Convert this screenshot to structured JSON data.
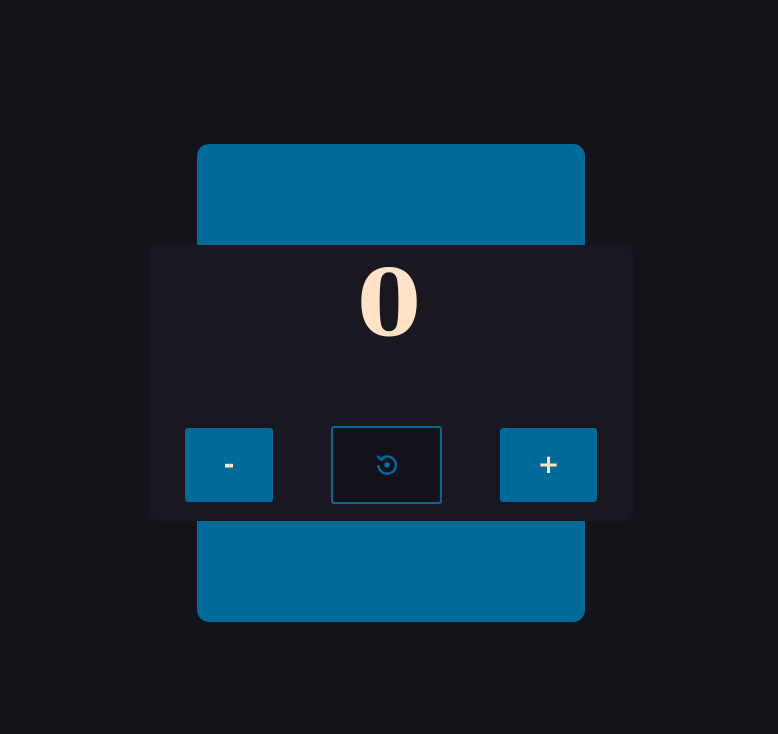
{
  "counter": {
    "value": "0",
    "decrement_label": "-",
    "increment_label": "+",
    "reset_icon": "reset-icon"
  },
  "colors": {
    "page_background": "#15131a",
    "accent": "#006a99",
    "panel": "#1b1720",
    "value_text": "#ffe3c8"
  }
}
